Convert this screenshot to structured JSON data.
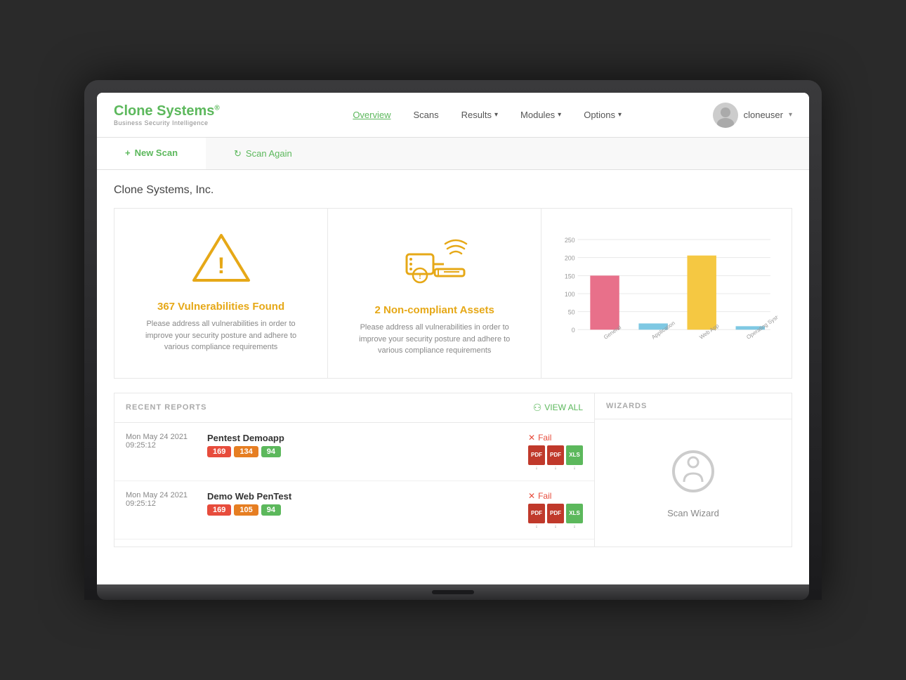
{
  "navbar": {
    "logo_main": "Clone Systems",
    "logo_main_plain": "Clone ",
    "logo_green": "Systems",
    "logo_sup": "®",
    "logo_sub": "Business Security Intelligence",
    "nav_items": [
      {
        "label": "Overview",
        "active": true,
        "has_dropdown": false
      },
      {
        "label": "Scans",
        "active": false,
        "has_dropdown": false
      },
      {
        "label": "Results",
        "active": false,
        "has_dropdown": true
      },
      {
        "label": "Modules",
        "active": false,
        "has_dropdown": true
      },
      {
        "label": "Options",
        "active": false,
        "has_dropdown": true
      }
    ],
    "username": "cloneuser"
  },
  "tabs": [
    {
      "label": "New Scan",
      "icon": "+",
      "type": "new-scan"
    },
    {
      "label": "Scan Again",
      "icon": "↻",
      "type": "scan-again"
    }
  ],
  "company": "Clone Systems, Inc.",
  "stats": [
    {
      "title": "367 Vulnerabilities Found",
      "description": "Please address all vulnerabilities in order to improve your security posture and adhere to various compliance requirements"
    },
    {
      "title": "2 Non-compliant Assets",
      "description": "Please address all vulnerabilities in order to improve your security posture and adhere to various compliance requirements"
    }
  ],
  "chart": {
    "y_labels": [
      "250",
      "200",
      "150",
      "100",
      "50",
      "0"
    ],
    "bars": [
      {
        "label": "General",
        "value": 150,
        "color": "#e8708a"
      },
      {
        "label": "Application",
        "value": 18,
        "color": "#7ec8e3"
      },
      {
        "label": "Web App",
        "value": 205,
        "color": "#f5c842"
      },
      {
        "label": "Operating Systems",
        "value": 10,
        "color": "#7ec8e3"
      }
    ],
    "max_value": 250
  },
  "recent_reports": {
    "title": "RECENT REPORTS",
    "view_all_label": "VIEW ALL",
    "items": [
      {
        "date": "Mon May 24 2021",
        "time": "09:25:12",
        "name": "Pentest Demoapp",
        "badges": [
          {
            "value": "169",
            "color": "red"
          },
          {
            "value": "134",
            "color": "orange"
          },
          {
            "value": "94",
            "color": "green"
          }
        ],
        "status": "Fail",
        "pdf_count": 3
      },
      {
        "date": "Mon May 24 2021",
        "time": "09:25:12",
        "name": "Demo Web PenTest",
        "badges": [
          {
            "value": "169",
            "color": "red"
          },
          {
            "value": "105",
            "color": "orange"
          },
          {
            "value": "94",
            "color": "green"
          }
        ],
        "status": "Fail",
        "pdf_count": 3
      }
    ]
  },
  "wizards": {
    "title": "WIZARDS",
    "scan_wizard_label": "Scan Wizard"
  }
}
